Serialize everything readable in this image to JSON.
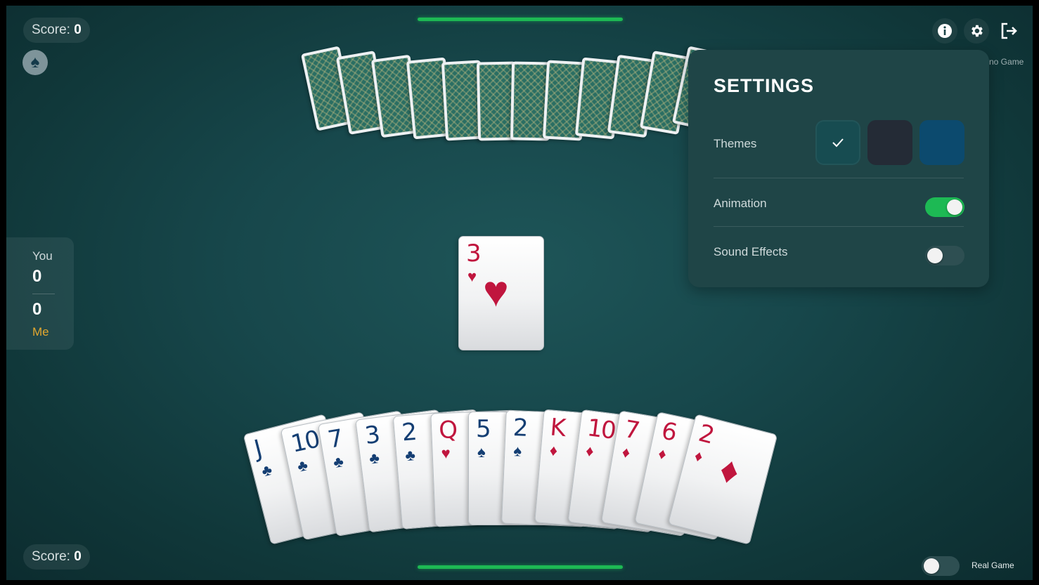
{
  "top_score": {
    "label": "Score:",
    "value": "0"
  },
  "bottom_score": {
    "label": "Score:",
    "value": "0"
  },
  "trump_suit_icon": "spade-icon",
  "scoreboard": {
    "you_label": "You",
    "you_value": "0",
    "me_value": "0",
    "me_label": "Me"
  },
  "header_icons": [
    "info-icon",
    "gear-icon",
    "exit-icon"
  ],
  "corner_top_right_label": "no Game",
  "turn_progress": {
    "top_fraction": 1.0,
    "bottom_fraction": 1.0
  },
  "center_card": {
    "rank": "3",
    "suit": "♥",
    "color": "red"
  },
  "opponent_card_count": 12,
  "player_hand": [
    {
      "rank": "J",
      "suit": "♣",
      "color": "blue"
    },
    {
      "rank": "10",
      "suit": "♣",
      "color": "blue"
    },
    {
      "rank": "7",
      "suit": "♣",
      "color": "blue"
    },
    {
      "rank": "3",
      "suit": "♣",
      "color": "blue"
    },
    {
      "rank": "2",
      "suit": "♣",
      "color": "blue"
    },
    {
      "rank": "Q",
      "suit": "♥",
      "color": "red"
    },
    {
      "rank": "5",
      "suit": "♠",
      "color": "blue"
    },
    {
      "rank": "2",
      "suit": "♠",
      "color": "blue"
    },
    {
      "rank": "K",
      "suit": "♦",
      "color": "red"
    },
    {
      "rank": "10",
      "suit": "♦",
      "color": "red"
    },
    {
      "rank": "7",
      "suit": "♦",
      "color": "red"
    },
    {
      "rank": "6",
      "suit": "♦",
      "color": "red"
    },
    {
      "rank": "2",
      "suit": "♦",
      "color": "red"
    }
  ],
  "settings": {
    "title": "SETTINGS",
    "themes_label": "Themes",
    "themes": [
      {
        "color": "#174c51",
        "selected": true
      },
      {
        "color": "#242b36",
        "selected": false
      },
      {
        "color": "#0c4a6e",
        "selected": false
      }
    ],
    "animation_label": "Animation",
    "animation_on": true,
    "sound_label": "Sound Effects",
    "sound_on": false
  },
  "real_game": {
    "label": "Real Game",
    "on": false
  },
  "colors": {
    "accent_green": "#1db954",
    "card_red": "#c0163e",
    "card_blue": "#143e73",
    "me_label": "#e3a72f"
  }
}
